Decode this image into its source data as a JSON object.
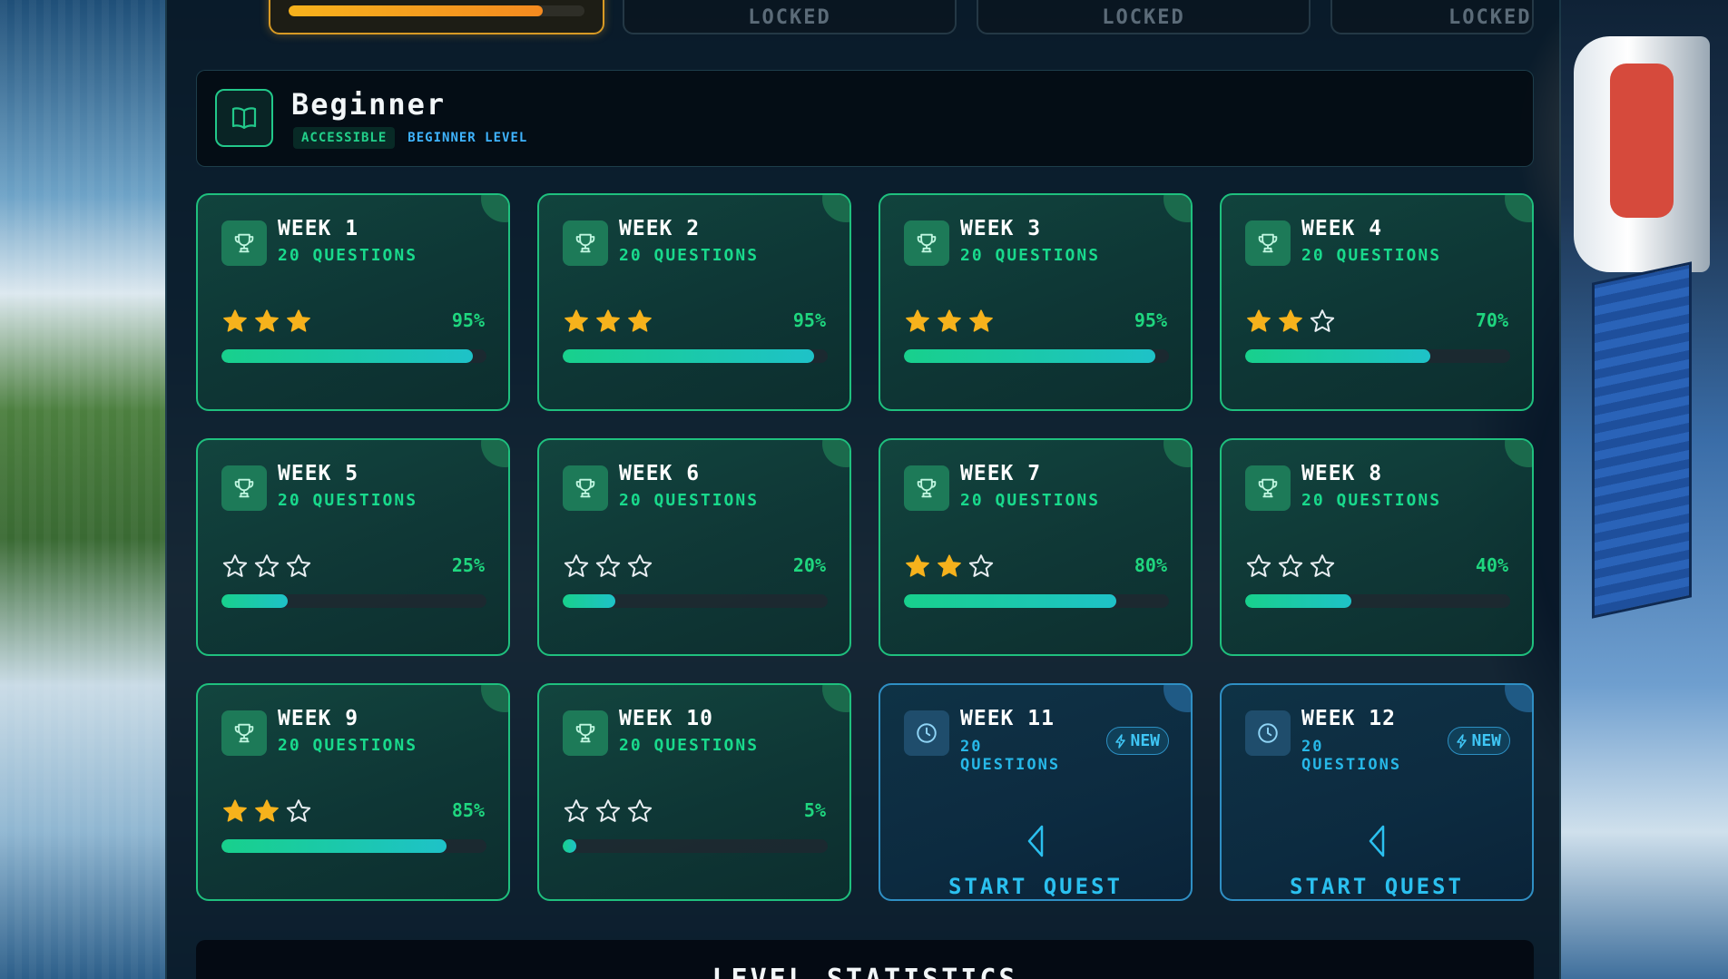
{
  "tiers": [
    {
      "label": "",
      "progress": 0.86,
      "active": true
    },
    {
      "label": "LOCKED",
      "active": false
    },
    {
      "label": "LOCKED",
      "active": false
    },
    {
      "label": "LOCKED",
      "active": false
    }
  ],
  "level": {
    "title": "Beginner",
    "status": "ACCESSIBLE",
    "level_label": "BEGINNER LEVEL",
    "icon": "book-icon"
  },
  "weeks": [
    {
      "title": "WEEK 1",
      "subtitle": "20 QUESTIONS",
      "stars": 3,
      "percent": "95%",
      "progress": 0.95,
      "new": false
    },
    {
      "title": "WEEK 2",
      "subtitle": "20 QUESTIONS",
      "stars": 3,
      "percent": "95%",
      "progress": 0.95,
      "new": false
    },
    {
      "title": "WEEK 3",
      "subtitle": "20 QUESTIONS",
      "stars": 3,
      "percent": "95%",
      "progress": 0.95,
      "new": false
    },
    {
      "title": "WEEK 4",
      "subtitle": "20 QUESTIONS",
      "stars": 2,
      "percent": "70%",
      "progress": 0.7,
      "new": false
    },
    {
      "title": "WEEK 5",
      "subtitle": "20 QUESTIONS",
      "stars": 0,
      "percent": "25%",
      "progress": 0.25,
      "new": false
    },
    {
      "title": "WEEK 6",
      "subtitle": "20 QUESTIONS",
      "stars": 0,
      "percent": "20%",
      "progress": 0.2,
      "new": false
    },
    {
      "title": "WEEK 7",
      "subtitle": "20 QUESTIONS",
      "stars": 2,
      "percent": "80%",
      "progress": 0.8,
      "new": false
    },
    {
      "title": "WEEK 8",
      "subtitle": "20 QUESTIONS",
      "stars": 0,
      "percent": "40%",
      "progress": 0.4,
      "new": false
    },
    {
      "title": "WEEK 9",
      "subtitle": "20 QUESTIONS",
      "stars": 2,
      "percent": "85%",
      "progress": 0.85,
      "new": false
    },
    {
      "title": "WEEK 10",
      "subtitle": "20 QUESTIONS",
      "stars": 0,
      "percent": "5%",
      "progress": 0.05,
      "new": false
    },
    {
      "title": "WEEK 11",
      "subtitle": "20 QUESTIONS",
      "new": true,
      "new_label": "NEW",
      "action": "START QUEST"
    },
    {
      "title": "WEEK 12",
      "subtitle": "20 QUESTIONS",
      "new": true,
      "new_label": "NEW",
      "action": "START QUEST"
    }
  ],
  "stats": {
    "title": "LEVEL STATISTICS"
  },
  "colors": {
    "accent_green": "#1fd67f",
    "accent_blue": "#2bc0ef",
    "star_gold": "#f6b21c",
    "tier_active": "#d89a24"
  }
}
